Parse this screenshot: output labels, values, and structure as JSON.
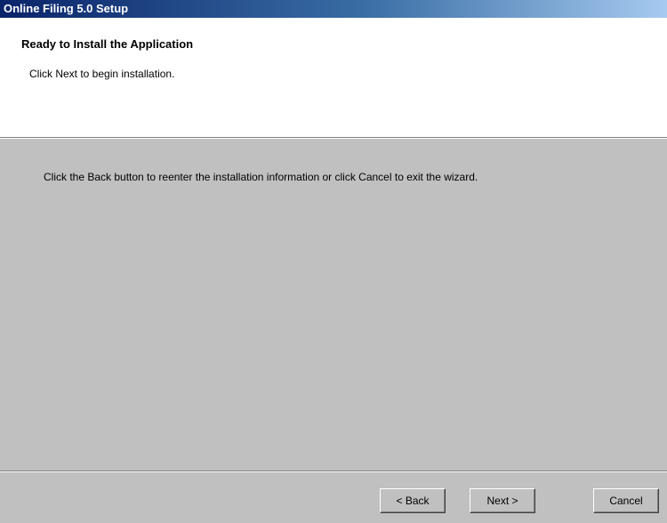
{
  "window": {
    "title": "Online Filing 5.0 Setup"
  },
  "header": {
    "heading": "Ready to Install the Application",
    "subtext": "Click Next to begin installation."
  },
  "main": {
    "instruction": "Click the Back button to reenter the installation information or click Cancel to exit the wizard."
  },
  "buttons": {
    "back_label": "< Back",
    "next_label": "Next >",
    "cancel_label": "Cancel"
  },
  "colors": {
    "title_bar_start": "#0a246a",
    "title_bar_end": "#a6caf0",
    "header_background": "#ffffff",
    "dialog_background": "#c0c0c0"
  }
}
